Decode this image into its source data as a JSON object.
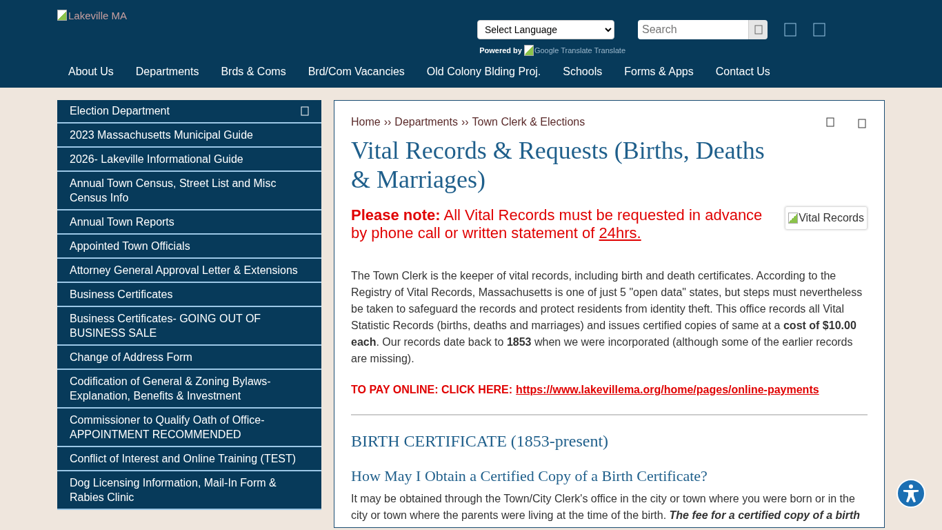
{
  "header": {
    "logo_alt": "Lakeville MA",
    "language_select": "Select Language",
    "search": {
      "placeholder": "Search"
    },
    "powered_by": "Powered by",
    "translate_alt": "Google Translate Translate"
  },
  "nav": [
    "About Us",
    "Departments",
    "Brds & Coms",
    "Brd/Com Vacancies",
    "Old Colony Blding Proj.",
    "Schools",
    "Forms & Apps",
    "Contact Us"
  ],
  "sidebar": {
    "title": "Election Department",
    "items": [
      "2023 Massachusetts Municipal Guide",
      "2026- Lakeville Informational Guide",
      "Annual Town Census, Street List and Misc Census Info",
      "Annual Town Reports",
      "Appointed Town Officials",
      "Attorney General Approval Letter & Extensions",
      "Business Certificates",
      "Business Certificates- GOING OUT OF BUSINESS SALE",
      "Change of Address Form",
      "Codification of General & Zoning Bylaws- Explanation, Benefits & Investment",
      "Commissioner to Qualify Oath of Office- APPOINTMENT RECOMMENDED",
      "Conflict of Interest and Online Training (TEST)",
      "Dog Licensing Information, Mail-In Form & Rabies Clinic"
    ]
  },
  "breadcrumb": [
    "Home",
    "Departments",
    "Town Clerk & Elections"
  ],
  "breadcrumb_separator": "››",
  "title": "Vital Records & Requests (Births, Deaths & Marriages)",
  "notice": {
    "text": "**Please note:** All Vital Records must be requested in advance by phone call or written statement of ",
    "link": "24hrs."
  },
  "image_alt": "Vital Records",
  "intro": "The Town Clerk is the keeper of vital records, including birth and death certificates.  According to the Registry of Vital Records, Massachusetts is one of just 5 \"open data\" states, but steps must nevertheless be taken to safeguard the records and protect residents from identity theft. This office records all Vital Statistic Records (births, deaths and marriages) and issues certified copies of same at a **cost of $10.00 each**. Our records date back to **1853** when we were incorporated (although some of the earlier records are missing).",
  "pay": {
    "label": "TO PAY ONLINE: CLICK HERE:",
    "link": "https://www.lakevillema.org/home/pages/online-payments"
  },
  "section_heading": "BIRTH CERTIFICATE (1853-present)",
  "subheading": "How May I Obtain a Certified Copy of a Birth Certificate?",
  "answer": "It may be obtained through the Town/City Clerk's office in the city or town where you were born or in the city or town where the parents were living at the time of the birth. **The fee for a certified copy of a birth**"
}
